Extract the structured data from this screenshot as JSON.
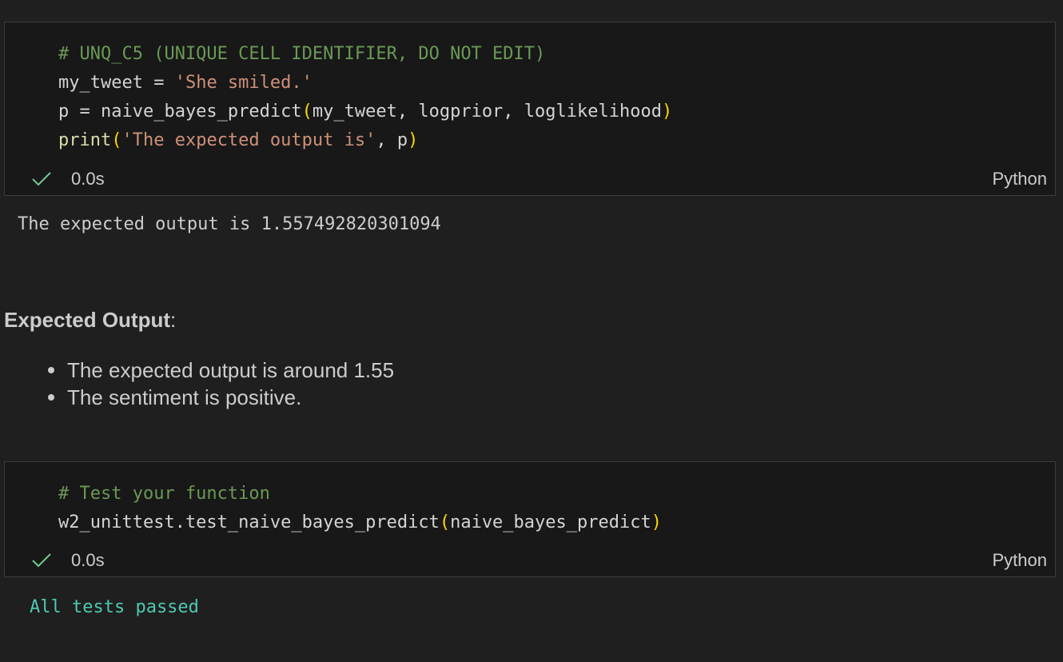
{
  "cells": [
    {
      "code_lines": [
        [
          {
            "t": "# UNQ_C5 (UNIQUE CELL IDENTIFIER, DO NOT EDIT)",
            "c": "comment"
          }
        ],
        [
          {
            "t": "my_tweet = ",
            "c": "plain"
          },
          {
            "t": "'She smiled.'",
            "c": "string"
          }
        ],
        [
          {
            "t": "p = naive_bayes_predict",
            "c": "plain"
          },
          {
            "t": "(",
            "c": "paren"
          },
          {
            "t": "my_tweet, logprior, loglikelihood",
            "c": "plain"
          },
          {
            "t": ")",
            "c": "paren"
          }
        ],
        [
          {
            "t": "print",
            "c": "func"
          },
          {
            "t": "(",
            "c": "paren"
          },
          {
            "t": "'The expected output is'",
            "c": "string"
          },
          {
            "t": ", p",
            "c": "plain"
          },
          {
            "t": ")",
            "c": "paren"
          }
        ]
      ],
      "exec_time": "0.0s",
      "language": "Python",
      "output": "The expected output is 1.557492820301094"
    },
    {
      "code_lines": [
        [
          {
            "t": "# Test your function",
            "c": "comment"
          }
        ],
        [
          {
            "t": "w2_unittest.test_naive_bayes_predict",
            "c": "plain"
          },
          {
            "t": "(",
            "c": "paren"
          },
          {
            "t": "naive_bayes_predict",
            "c": "plain"
          },
          {
            "t": ")",
            "c": "paren"
          }
        ]
      ],
      "exec_time": "0.0s",
      "language": "Python",
      "output": "All tests passed"
    }
  ],
  "markdown": {
    "heading_bold": "Expected Output",
    "heading_suffix": ":",
    "bullets": [
      "The expected output is around 1.55",
      "The sentiment is positive."
    ]
  },
  "colors": {
    "background": "#1f1f1f",
    "cell_background": "#181818",
    "comment": "#6a9955",
    "string": "#ce9178",
    "function": "#dcdcaa",
    "bracket": "#ffd700",
    "success": "#4ec9b0",
    "check": "#73c991"
  },
  "icons": {
    "status": "check-icon"
  }
}
